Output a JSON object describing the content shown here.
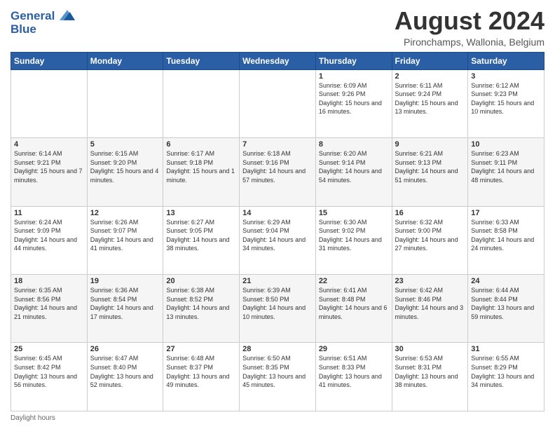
{
  "header": {
    "logo_line1": "General",
    "logo_line2": "Blue",
    "month": "August 2024",
    "location": "Pironchamps, Wallonia, Belgium"
  },
  "days_of_week": [
    "Sunday",
    "Monday",
    "Tuesday",
    "Wednesday",
    "Thursday",
    "Friday",
    "Saturday"
  ],
  "weeks": [
    [
      {
        "day": "",
        "info": ""
      },
      {
        "day": "",
        "info": ""
      },
      {
        "day": "",
        "info": ""
      },
      {
        "day": "",
        "info": ""
      },
      {
        "day": "1",
        "info": "Sunrise: 6:09 AM\nSunset: 9:26 PM\nDaylight: 15 hours\nand 16 minutes."
      },
      {
        "day": "2",
        "info": "Sunrise: 6:11 AM\nSunset: 9:24 PM\nDaylight: 15 hours\nand 13 minutes."
      },
      {
        "day": "3",
        "info": "Sunrise: 6:12 AM\nSunset: 9:23 PM\nDaylight: 15 hours\nand 10 minutes."
      }
    ],
    [
      {
        "day": "4",
        "info": "Sunrise: 6:14 AM\nSunset: 9:21 PM\nDaylight: 15 hours\nand 7 minutes."
      },
      {
        "day": "5",
        "info": "Sunrise: 6:15 AM\nSunset: 9:20 PM\nDaylight: 15 hours\nand 4 minutes."
      },
      {
        "day": "6",
        "info": "Sunrise: 6:17 AM\nSunset: 9:18 PM\nDaylight: 15 hours\nand 1 minute."
      },
      {
        "day": "7",
        "info": "Sunrise: 6:18 AM\nSunset: 9:16 PM\nDaylight: 14 hours\nand 57 minutes."
      },
      {
        "day": "8",
        "info": "Sunrise: 6:20 AM\nSunset: 9:14 PM\nDaylight: 14 hours\nand 54 minutes."
      },
      {
        "day": "9",
        "info": "Sunrise: 6:21 AM\nSunset: 9:13 PM\nDaylight: 14 hours\nand 51 minutes."
      },
      {
        "day": "10",
        "info": "Sunrise: 6:23 AM\nSunset: 9:11 PM\nDaylight: 14 hours\nand 48 minutes."
      }
    ],
    [
      {
        "day": "11",
        "info": "Sunrise: 6:24 AM\nSunset: 9:09 PM\nDaylight: 14 hours\nand 44 minutes."
      },
      {
        "day": "12",
        "info": "Sunrise: 6:26 AM\nSunset: 9:07 PM\nDaylight: 14 hours\nand 41 minutes."
      },
      {
        "day": "13",
        "info": "Sunrise: 6:27 AM\nSunset: 9:05 PM\nDaylight: 14 hours\nand 38 minutes."
      },
      {
        "day": "14",
        "info": "Sunrise: 6:29 AM\nSunset: 9:04 PM\nDaylight: 14 hours\nand 34 minutes."
      },
      {
        "day": "15",
        "info": "Sunrise: 6:30 AM\nSunset: 9:02 PM\nDaylight: 14 hours\nand 31 minutes."
      },
      {
        "day": "16",
        "info": "Sunrise: 6:32 AM\nSunset: 9:00 PM\nDaylight: 14 hours\nand 27 minutes."
      },
      {
        "day": "17",
        "info": "Sunrise: 6:33 AM\nSunset: 8:58 PM\nDaylight: 14 hours\nand 24 minutes."
      }
    ],
    [
      {
        "day": "18",
        "info": "Sunrise: 6:35 AM\nSunset: 8:56 PM\nDaylight: 14 hours\nand 21 minutes."
      },
      {
        "day": "19",
        "info": "Sunrise: 6:36 AM\nSunset: 8:54 PM\nDaylight: 14 hours\nand 17 minutes."
      },
      {
        "day": "20",
        "info": "Sunrise: 6:38 AM\nSunset: 8:52 PM\nDaylight: 14 hours\nand 13 minutes."
      },
      {
        "day": "21",
        "info": "Sunrise: 6:39 AM\nSunset: 8:50 PM\nDaylight: 14 hours\nand 10 minutes."
      },
      {
        "day": "22",
        "info": "Sunrise: 6:41 AM\nSunset: 8:48 PM\nDaylight: 14 hours\nand 6 minutes."
      },
      {
        "day": "23",
        "info": "Sunrise: 6:42 AM\nSunset: 8:46 PM\nDaylight: 14 hours\nand 3 minutes."
      },
      {
        "day": "24",
        "info": "Sunrise: 6:44 AM\nSunset: 8:44 PM\nDaylight: 13 hours\nand 59 minutes."
      }
    ],
    [
      {
        "day": "25",
        "info": "Sunrise: 6:45 AM\nSunset: 8:42 PM\nDaylight: 13 hours\nand 56 minutes."
      },
      {
        "day": "26",
        "info": "Sunrise: 6:47 AM\nSunset: 8:40 PM\nDaylight: 13 hours\nand 52 minutes."
      },
      {
        "day": "27",
        "info": "Sunrise: 6:48 AM\nSunset: 8:37 PM\nDaylight: 13 hours\nand 49 minutes."
      },
      {
        "day": "28",
        "info": "Sunrise: 6:50 AM\nSunset: 8:35 PM\nDaylight: 13 hours\nand 45 minutes."
      },
      {
        "day": "29",
        "info": "Sunrise: 6:51 AM\nSunset: 8:33 PM\nDaylight: 13 hours\nand 41 minutes."
      },
      {
        "day": "30",
        "info": "Sunrise: 6:53 AM\nSunset: 8:31 PM\nDaylight: 13 hours\nand 38 minutes."
      },
      {
        "day": "31",
        "info": "Sunrise: 6:55 AM\nSunset: 8:29 PM\nDaylight: 13 hours\nand 34 minutes."
      }
    ]
  ],
  "footer": "Daylight hours"
}
